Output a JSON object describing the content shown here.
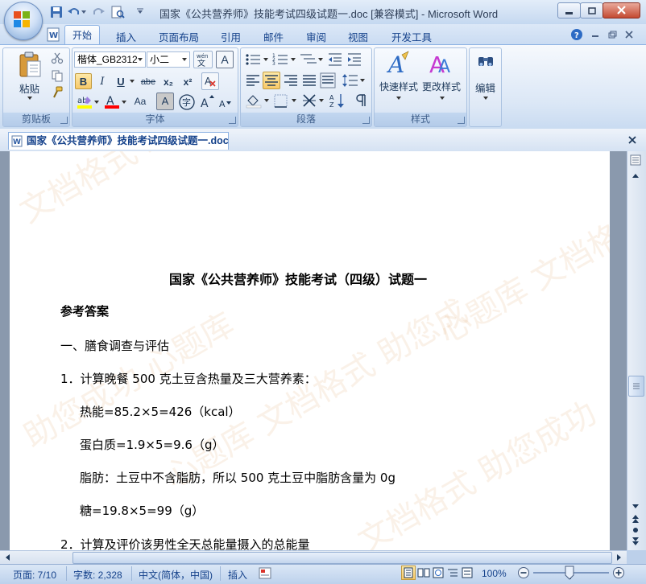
{
  "window": {
    "title": "国家《公共营养师》技能考试四级试题一.doc [兼容模式] - Microsoft Word"
  },
  "ribbon_tabs": [
    "开始",
    "插入",
    "页面布局",
    "引用",
    "邮件",
    "审阅",
    "视图",
    "开发工具"
  ],
  "clipboard": {
    "paste_label": "粘贴",
    "group_label": "剪贴板"
  },
  "font": {
    "font_name": "楷体_GB2312",
    "font_size": "小二",
    "group_label": "字体",
    "buttons": {
      "bold": "B",
      "italic": "I",
      "underline": "U",
      "strike": "abe",
      "subscript": "x₂",
      "superscript": "x²",
      "change_case": "Aa",
      "grow": "A",
      "shrink": "A",
      "char_border": "A",
      "enclose": "字",
      "phonetic": "wén",
      "clear": "A"
    }
  },
  "paragraph": {
    "group_label": "段落"
  },
  "styles": {
    "quick_styles_label": "快速样式",
    "change_styles_label": "更改样式",
    "group_label": "样式"
  },
  "editing": {
    "label": "编辑"
  },
  "document_tab": {
    "title": "国家《公共营养师》技能考试四级试题一.doc"
  },
  "document": {
    "watermark": [
      "文档格式  助您成功",
      "心题库  文档格式  助您成",
      "助您成功  心题库",
      "文档格式  助您成功",
      "心题库  文档格式"
    ],
    "heading": "国家《公共营养师》技能考试（四级）试题一",
    "answers_label": "参考答案",
    "section_1": "一、膳食调查与评估",
    "q1": "1．计算晚餐 500 克土豆含热量及三大营养素：",
    "energy": "热能=85.2×5=426（kcal）",
    "protein": "蛋白质=1.9×5=9.6（g）",
    "fat": "脂肪：土豆中不含脂肪，所以 500 克土豆中脂肪含量为 0g",
    "sugar": "糖=19.8×5=99（g）",
    "q2": "2．计算及评价该男性全天总能量摄入的总能量"
  },
  "status_bar": {
    "page": "页面: 7/10",
    "words": "字数: 2,328",
    "language": "中文(简体，中国)",
    "mode": "插入",
    "zoom": "100%"
  },
  "colors": {
    "ribbon_blue": "#c9dbf2",
    "text_blue": "#15428b",
    "highlight_yellow": "#ffff00",
    "font_color_red": "#ff0000",
    "selected_orange": "#f8c969"
  }
}
